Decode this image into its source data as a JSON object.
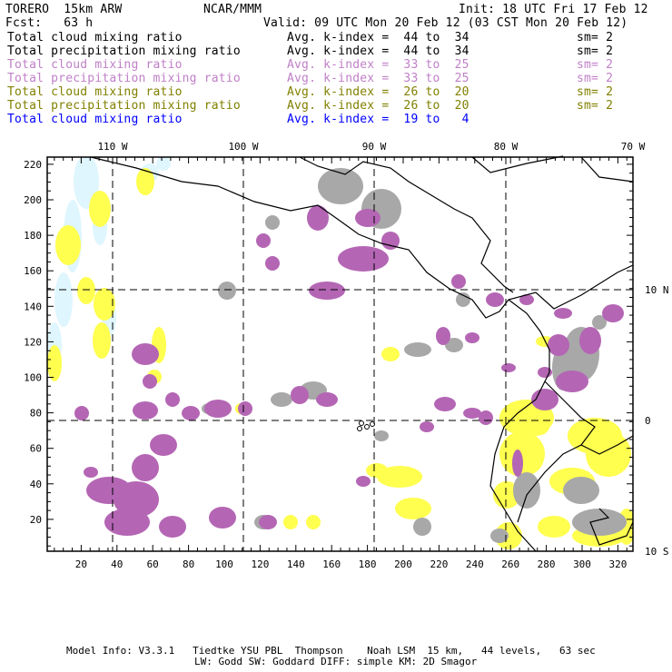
{
  "header": {
    "model": "TORERO  15km ARW",
    "org": "NCAR/MMM",
    "init": "Init: 18 UTC Fri 17 Feb 12",
    "fcst": "Fcst:   63 h",
    "valid": "Valid: 09 UTC Mon 20 Feb 12 (03 CST Mon 20 Feb 12)"
  },
  "legend": [
    {
      "field": "Total cloud mixing ratio",
      "range": "Avg. k-index =  44 to  34",
      "sm": "sm= 2",
      "color": "#000000"
    },
    {
      "field": "Total precipitation mixing ratio",
      "range": "Avg. k-index =  44 to  34",
      "sm": "sm= 2",
      "color": "#000000"
    },
    {
      "field": "Total cloud mixing ratio",
      "range": "Avg. k-index =  33 to  25",
      "sm": "sm= 2",
      "color": "#c080c8"
    },
    {
      "field": "Total precipitation mixing ratio",
      "range": "Avg. k-index =  33 to  25",
      "sm": "sm= 2",
      "color": "#c080c8"
    },
    {
      "field": "Total cloud mixing ratio",
      "range": "Avg. k-index =  26 to  20",
      "sm": "sm= 2",
      "color": "#808000"
    },
    {
      "field": "Total precipitation mixing ratio",
      "range": "Avg. k-index =  26 to  20",
      "sm": "sm= 2",
      "color": "#808000"
    },
    {
      "field": "Total cloud mixing ratio",
      "range": "Avg. k-index =  19 to   4",
      "sm": "",
      "color": "#0000ff"
    }
  ],
  "map": {
    "lon_labels": [
      "110 W",
      "100 W",
      "90 W",
      "80 W",
      "70 W"
    ],
    "lat_labels": [
      "10 N",
      "0",
      "10 S"
    ],
    "x_ticks": [
      "20",
      "40",
      "60",
      "80",
      "100",
      "120",
      "140",
      "160",
      "180",
      "200",
      "220",
      "240",
      "260",
      "280",
      "300",
      "320"
    ],
    "y_ticks": [
      "220",
      "200",
      "180",
      "160",
      "140",
      "120",
      "100",
      "80",
      "60",
      "40",
      "20"
    ],
    "colors": {
      "cloud_high": "#a8a8a8",
      "cloud_mid": "#b466b4",
      "cloud_low": "#ffff50",
      "cloud_shallow": "#dff6ff"
    }
  },
  "footer": {
    "line1": "Model Info: V3.3.1   Tiedtke YSU PBL  Thompson    Noah LSM  15 km,   44 levels,   63 sec",
    "line2": "LW: Godd SW: Goddard DIFF: simple KM: 2D Smagor"
  }
}
